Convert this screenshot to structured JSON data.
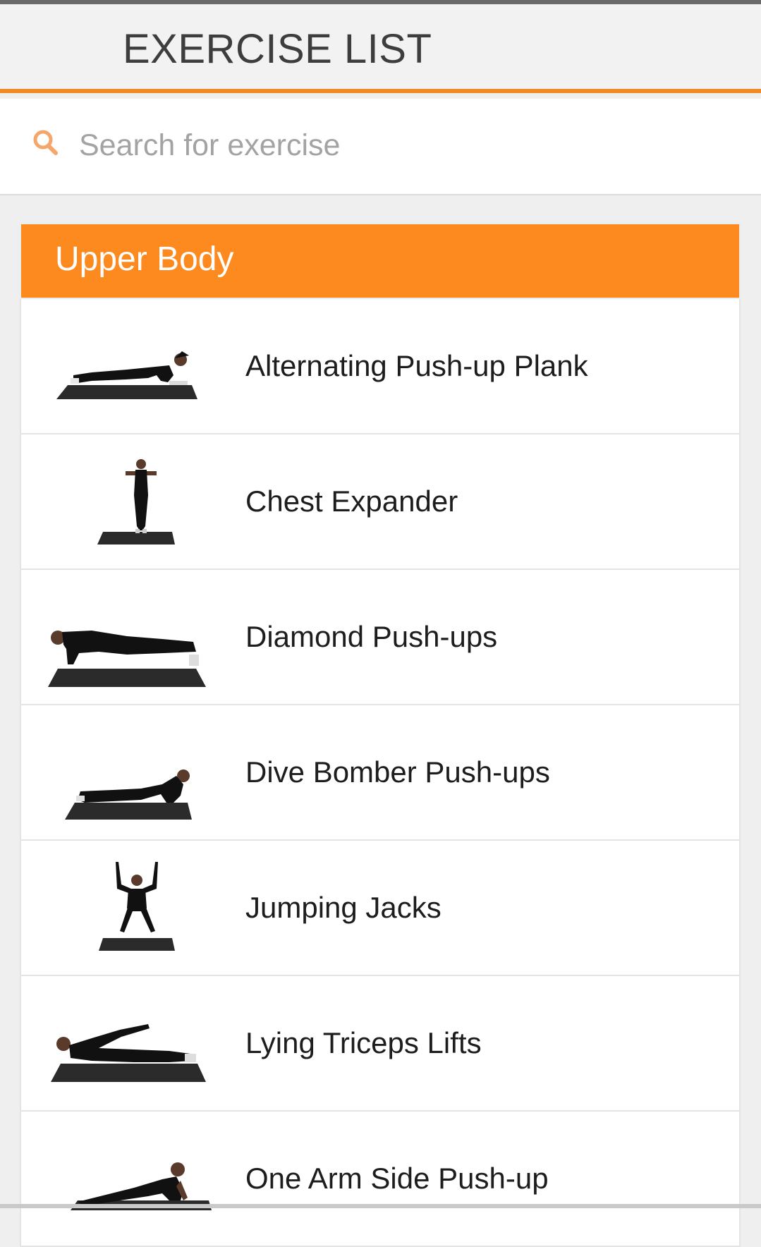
{
  "header": {
    "title": "EXERCISE LIST"
  },
  "search": {
    "placeholder": "Search for exercise",
    "value": "",
    "icon": "search-icon"
  },
  "section": {
    "title": "Upper Body",
    "color": "#fd8a1f"
  },
  "exercises": [
    {
      "name": "Alternating Push-up Plank",
      "thumb": "plank-figure"
    },
    {
      "name": "Chest Expander",
      "thumb": "standing-arms-front-figure"
    },
    {
      "name": "Diamond Push-ups",
      "thumb": "pushup-figure"
    },
    {
      "name": "Dive Bomber Push-ups",
      "thumb": "dive-bomber-figure"
    },
    {
      "name": "Jumping Jacks",
      "thumb": "jumping-jack-figure"
    },
    {
      "name": "Lying Triceps Lifts",
      "thumb": "lying-lift-figure"
    },
    {
      "name": "One Arm Side Push-up",
      "thumb": "side-pushup-figure"
    }
  ],
  "colors": {
    "accent": "#f08a24",
    "header_bg": "#f2f2f2",
    "mat": "#2b2b2b",
    "figure": "#111111",
    "skin": "#5a3a2a"
  }
}
